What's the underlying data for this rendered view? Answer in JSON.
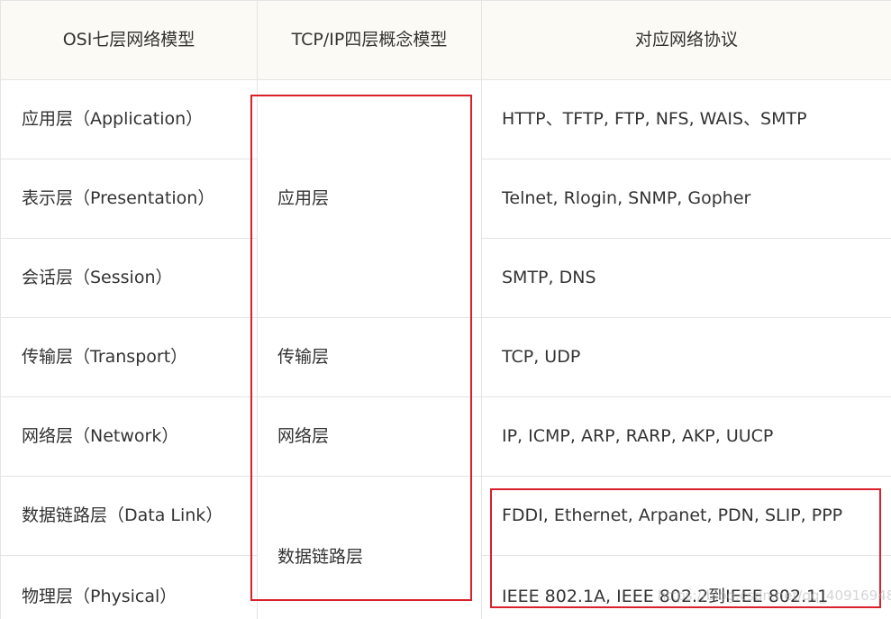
{
  "headers": [
    "OSI七层网络模型",
    "TCP/IP四层概念模型",
    "对应网络协议"
  ],
  "rows": [
    {
      "osi": "应用层（Application）",
      "protocols": "HTTP、TFTP, FTP, NFS, WAIS、SMTP"
    },
    {
      "osi": "表示层（Presentation）",
      "protocols": "Telnet, Rlogin, SNMP, Gopher"
    },
    {
      "osi": "会话层（Session）",
      "protocols": "SMTP, DNS"
    },
    {
      "osi": "传输层（Transport）",
      "protocols": "TCP, UDP"
    },
    {
      "osi": "网络层（Network）",
      "protocols": "IP, ICMP, ARP, RARP, AKP, UUCP"
    },
    {
      "osi": "数据链路层（Data Link）",
      "protocols": "FDDI, Ethernet, Arpanet, PDN, SLIP, PPP"
    },
    {
      "osi": "物理层（Physical）",
      "protocols": "IEEE 802.1A, IEEE 802.2到IEEE 802.11"
    }
  ],
  "tcpip": [
    "应用层",
    "传输层",
    "网络层",
    "数据链路层"
  ],
  "watermark": "https://blog.csdn.net/qq_40916948",
  "colors": {
    "header_bg": "#fbfaf4",
    "border": "#e4e4e4",
    "highlight": "#d9202c",
    "text": "#333333"
  }
}
